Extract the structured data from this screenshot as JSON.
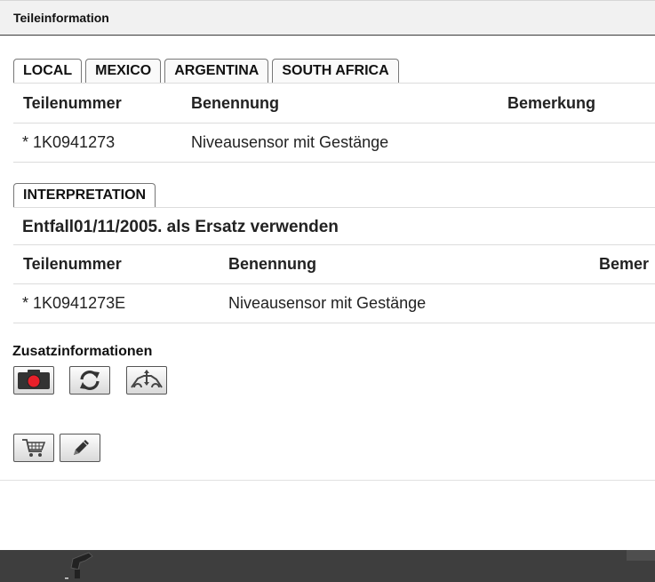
{
  "window": {
    "title": "Teileinformation"
  },
  "country_tabs": [
    "LOCAL",
    "MEXICO",
    "ARGENTINA",
    "SOUTH AFRICA"
  ],
  "local_table": {
    "headers": [
      "Teilenummer",
      "Benennung",
      "Bemerkung"
    ],
    "rows": [
      {
        "part_number": "* 1K0941273",
        "name": "Niveausensor mit Gestänge"
      }
    ]
  },
  "interpretation_tab": "INTERPRETATION",
  "interpretation": {
    "note": "Entfall01/11/2005. als Ersatz verwenden",
    "headers": [
      "Teilenummer",
      "Benennung",
      "Bemer"
    ],
    "rows": [
      {
        "part_number": "* 1K0941273E",
        "name": "Niveausensor mit Gestänge"
      }
    ]
  },
  "additional": {
    "heading": "Zusatzinformationen"
  },
  "icons": {
    "photo": "camera-icon",
    "refresh": "refresh-icon",
    "vehicle": "vehicle-height-icon",
    "cart": "cart-icon",
    "edit": "pencil-icon"
  },
  "colors": {
    "camera_dot": "#e8202a",
    "footer_bar": "#3e3e3e"
  }
}
